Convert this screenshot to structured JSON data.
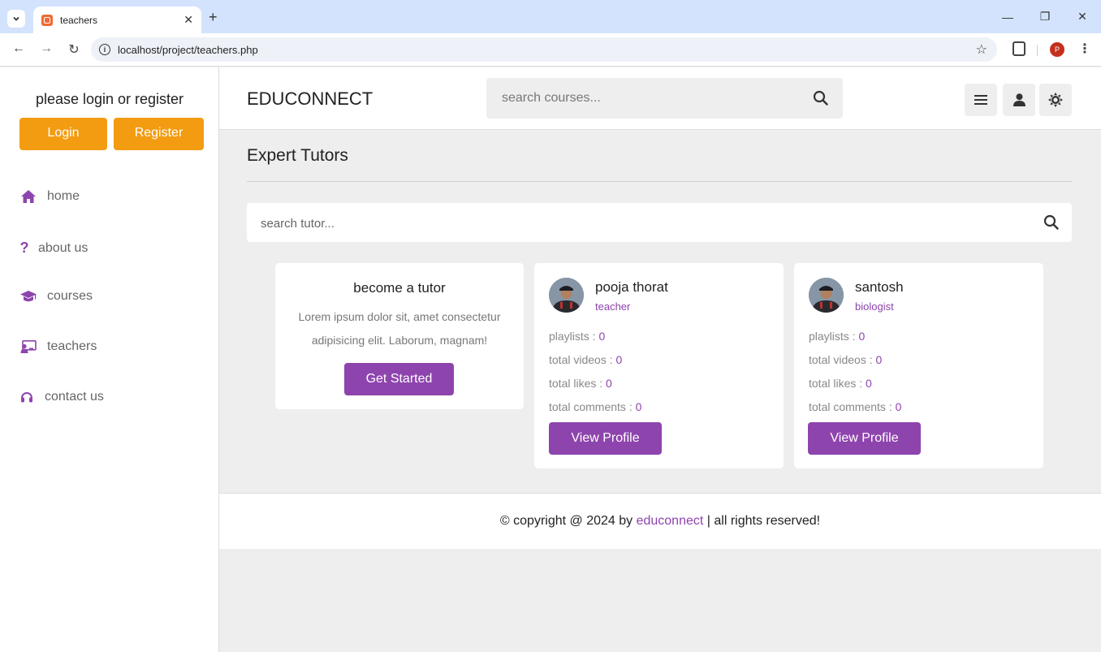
{
  "browser": {
    "tab_title": "teachers",
    "url": "localhost/project/teachers.php",
    "profile_initial": "P"
  },
  "sidebar": {
    "login_prompt": "please login or register",
    "login_label": "Login",
    "register_label": "Register",
    "links": [
      {
        "label": "home",
        "icon": "home-icon"
      },
      {
        "label": "about us",
        "icon": "question-icon"
      },
      {
        "label": "courses",
        "icon": "graduation-cap-icon"
      },
      {
        "label": "teachers",
        "icon": "chalkboard-teacher-icon"
      },
      {
        "label": "contact us",
        "icon": "headset-icon"
      }
    ]
  },
  "header": {
    "logo": "EDUCONNECT",
    "search_placeholder": "search courses..."
  },
  "main": {
    "heading": "Expert Tutors",
    "tutor_search_placeholder": "search tutor...",
    "offer": {
      "title": "become a tutor",
      "text": "Lorem ipsum dolor sit, amet consectetur adipisicing elit. Laborum, magnam!",
      "button": "Get Started"
    },
    "tutors": [
      {
        "name": "pooja thorat",
        "profession": "teacher",
        "playlists_label": "playlists : ",
        "playlists": "0",
        "videos_label": "total videos : ",
        "videos": "0",
        "likes_label": "total likes : ",
        "likes": "0",
        "comments_label": "total comments : ",
        "comments": "0",
        "button": "View Profile"
      },
      {
        "name": "santosh",
        "profession": "biologist",
        "playlists_label": "playlists : ",
        "playlists": "0",
        "videos_label": "total videos : ",
        "videos": "0",
        "likes_label": "total likes : ",
        "likes": "0",
        "comments_label": "total comments : ",
        "comments": "0",
        "button": "View Profile"
      }
    ]
  },
  "footer": {
    "prefix": "© copyright @ 2024 by ",
    "brand": "educonnect",
    "suffix": " | all rights reserved!"
  },
  "colors": {
    "accent": "#8e44ad",
    "orange": "#f39c12",
    "background": "#eeeeee"
  }
}
